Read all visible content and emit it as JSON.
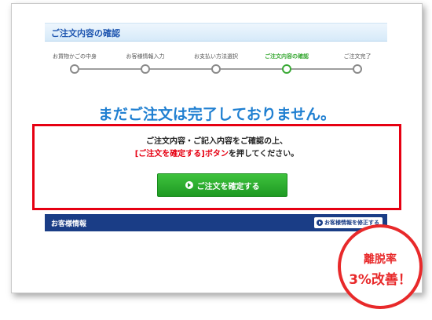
{
  "header": {
    "title": "ご注文内容の確認"
  },
  "steps": [
    {
      "label": "お買物かごの中身",
      "active": false
    },
    {
      "label": "お客様情報入力",
      "active": false
    },
    {
      "label": "お支払い方法選択",
      "active": false
    },
    {
      "label": "ご注文内容の確認",
      "active": true
    },
    {
      "label": "ご注文完了",
      "active": false
    }
  ],
  "main": {
    "headline": "まだご注文は完了しておりません。"
  },
  "alert": {
    "line1": "ご注文内容・ご記入内容をご確認の上、",
    "line2_red": "[ご注文を確定する]ボタン",
    "line2_rest": "を押してください。",
    "confirm_button": "ご注文を確定する"
  },
  "customer": {
    "title": "お客様情報",
    "edit_button": "お客様情報を修正する"
  },
  "badge": {
    "line1": "離脱率",
    "line2": "3%改善！"
  },
  "colors": {
    "accent_blue": "#1f7fd1",
    "alert_red": "#e60012",
    "button_green": "#1e9a23",
    "navy": "#1a3d86"
  },
  "icons": [
    "play-circle-icon",
    "play-circle-icon"
  ]
}
